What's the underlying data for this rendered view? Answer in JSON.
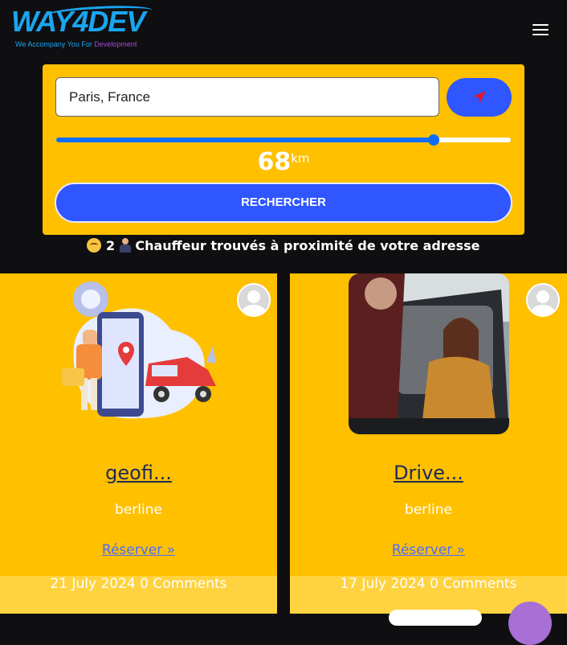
{
  "header": {
    "logo_text": "WAY4DEV",
    "logo_tagline_start": "We Accompany You For ",
    "logo_tagline_accent": "Development",
    "menu_icon": "hamburger-icon"
  },
  "search": {
    "location_value": "Paris, France",
    "locate_icon": "location-arrow-icon",
    "radius_value": "68",
    "radius_unit": "km",
    "radius_fraction": 0.83,
    "search_label": "RECHERCHER"
  },
  "results": {
    "count": "2",
    "text": "Chauffeur trouvés à proximité de votre adresse"
  },
  "cards": [
    {
      "title": "geofi...",
      "type": "berline",
      "link": "Réserver »",
      "date": "21 July 2024",
      "comments": "0 Comments"
    },
    {
      "title": "Drive...",
      "type": "berline",
      "link": "Réserver »",
      "date": "17 July 2024",
      "comments": "0 Comments"
    }
  ],
  "colors": {
    "panel": "#ffc000",
    "primary": "#2f56ff",
    "background": "#0f0f11"
  }
}
